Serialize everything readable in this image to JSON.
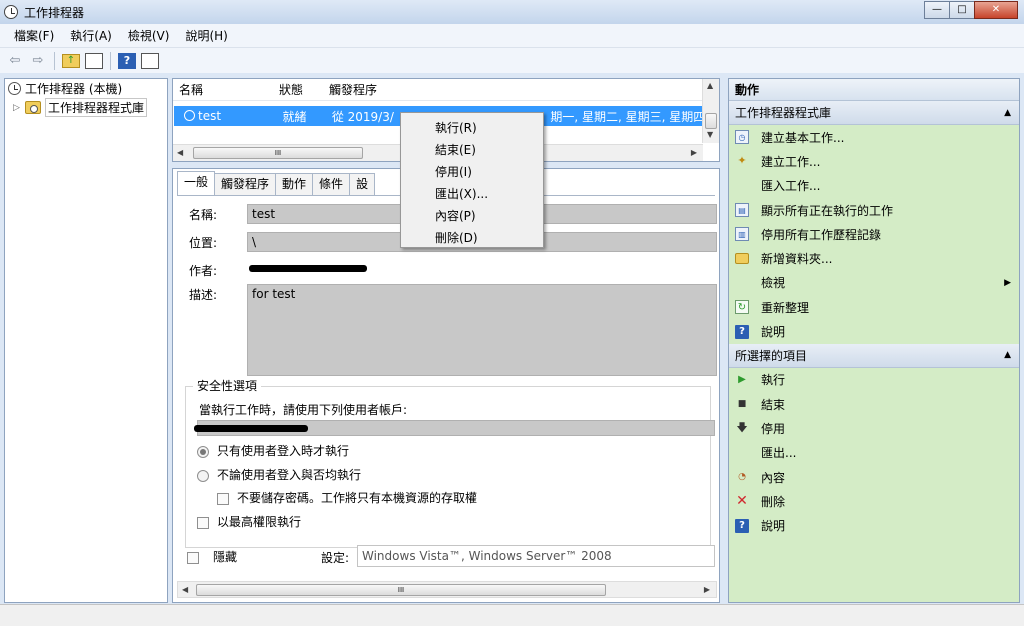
{
  "window": {
    "title": "工作排程器",
    "controls": {
      "minimize": "—",
      "maximize": "□",
      "close": "✕"
    }
  },
  "menu": [
    "檔案(F)",
    "執行(A)",
    "檢視(V)",
    "說明(H)"
  ],
  "toolbar": {
    "icons": [
      "back-arrow-icon",
      "forward-arrow-icon",
      "folder-up-icon",
      "show-hide-tree-icon",
      "help-icon",
      "show-hide-action-pane-icon"
    ]
  },
  "tree": {
    "root": "工作排程器 (本機)",
    "child": "工作排程器程式庫",
    "expander": "▷"
  },
  "task_list": {
    "columns": [
      "名稱",
      "狀態",
      "觸發程序"
    ],
    "rows": [
      {
        "name": "test",
        "status": "就緒",
        "trigger": "從 2019/3/",
        "trigger_tail": "期一, 星期二, 星期三, 星期四,"
      }
    ],
    "hscroll_label": "III"
  },
  "detail": {
    "tabs": [
      "一般",
      "觸發程序",
      "動作",
      "條件",
      "設"
    ],
    "name_label": "名稱:",
    "name_value": "test",
    "location_label": "位置:",
    "location_value": "\\",
    "author_label": "作者:",
    "description_label": "描述:",
    "description_value": "for test",
    "security": {
      "legend": "安全性選項",
      "account_prompt": "當執行工作時，請使用下列使用者帳戶:",
      "option_logged_on": "只有使用者登入時才執行",
      "option_whether": "不論使用者登入與否均執行",
      "option_no_password": "不要儲存密碼。工作將只有本機資源的存取權",
      "option_highest": "以最高權限執行"
    },
    "hidden_label": "隱藏",
    "configure_label": "設定:",
    "configure_value": "Windows Vista™, Windows Server™ 2008",
    "hscroll_label": "III"
  },
  "context_menu": [
    "執行(R)",
    "結束(E)",
    "停用(I)",
    "匯出(X)...",
    "內容(P)",
    "刪除(D)"
  ],
  "actions": {
    "header": "動作",
    "library_section": "工作排程器程式庫",
    "library_items": [
      "建立基本工作...",
      "建立工作...",
      "匯入工作...",
      "顯示所有正在執行的工作",
      "停用所有工作歷程記錄",
      "新增資料夾...",
      "檢視",
      "重新整理",
      "說明"
    ],
    "selected_section": "所選擇的項目",
    "selected_items": [
      "執行",
      "結束",
      "停用",
      "匯出...",
      "內容",
      "刪除",
      "說明"
    ],
    "collapse_glyph": "▲",
    "submenu_glyph": "▶"
  },
  "colors": {
    "selection": "#3399ff",
    "actions_bg": "#d4ecc6",
    "frame": "#dce7f5"
  }
}
